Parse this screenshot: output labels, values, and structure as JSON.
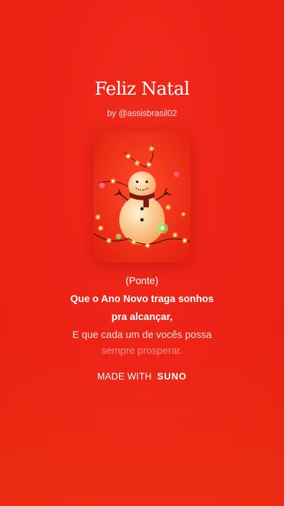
{
  "song": {
    "title": "Feliz Natal",
    "author": "by @assisbrasil02"
  },
  "cover": {
    "icon": "snowman-christmas-lights-image"
  },
  "lyrics": [
    "(Ponte)",
    "Que o Ano Novo traga sonhos",
    "pra alcançar,",
    "E que cada um de vocês possa",
    "sempre prosperar."
  ],
  "footer": {
    "made_with": "MADE WITH",
    "brand": "SUNO"
  },
  "colors": {
    "background": "#ee2216",
    "text": "#ffffff"
  }
}
